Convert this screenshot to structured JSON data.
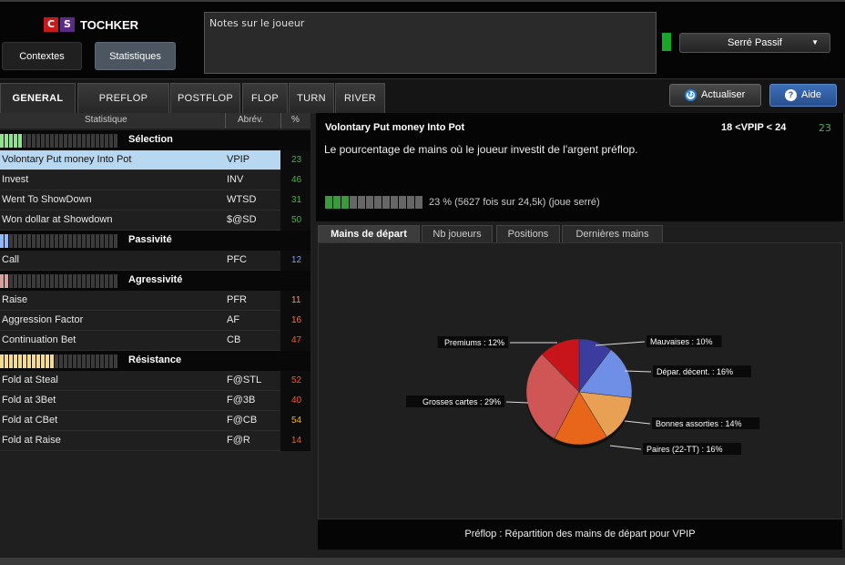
{
  "header": {
    "logo_c": "C",
    "logo_s": "S",
    "logo_name": "TOCHKER",
    "contextes_label": "Contextes",
    "statistiques_label": "Statistiques",
    "notes_placeholder": "Notes sur le joueur",
    "player_type": "Serré Passif"
  },
  "tabs": [
    "GENERAL",
    "PREFLOP",
    "POSTFLOP",
    "FLOP",
    "TURN",
    "RIVER"
  ],
  "actions": {
    "actualiser": "Actualiser",
    "aide": "Aide"
  },
  "table": {
    "col_stat": "Statistique",
    "col_abbr": "Abrév.",
    "col_pct": "%",
    "sections": [
      {
        "title": "Sélection",
        "meter_color": "#8fe38f",
        "meter_lit": 5,
        "rows": [
          {
            "label": "Volontary Put money Into Pot",
            "abbr": "VPIP",
            "value": "23",
            "color": "#4caf50",
            "selected": true
          },
          {
            "label": "Invest",
            "abbr": "INV",
            "value": "46",
            "color": "#4caf50"
          },
          {
            "label": "Went To ShowDown",
            "abbr": "WTSD",
            "value": "31",
            "color": "#4caf50"
          },
          {
            "label": "Won dollar at Showdown",
            "abbr": "$@SD",
            "value": "50",
            "color": "#4caf50"
          }
        ]
      },
      {
        "title": "Passivité",
        "meter_color": "#8fb8ff",
        "meter_lit": 2,
        "rows": [
          {
            "label": "Call",
            "abbr": "PFC",
            "value": "12",
            "color": "#6fa0ff"
          }
        ]
      },
      {
        "title": "Agressivité",
        "meter_color": "#d9a0a0",
        "meter_lit": 2,
        "rows": [
          {
            "label": "Raise",
            "abbr": "PFR",
            "value": "11",
            "color": "#ff8a65"
          },
          {
            "label": "Aggression Factor",
            "abbr": "AF",
            "value": "16",
            "color": "#ff7043"
          },
          {
            "label": "Continuation Bet",
            "abbr": "CB",
            "value": "47",
            "color": "#ff5722"
          }
        ]
      },
      {
        "title": "Résistance",
        "meter_color": "#f5dc8c",
        "meter_lit": 12,
        "rows": [
          {
            "label": "Fold at Steal",
            "abbr": "F@STL",
            "value": "52",
            "color": "#ff5722"
          },
          {
            "label": "Fold at 3Bet",
            "abbr": "F@3B",
            "value": "40",
            "color": "#ff5722"
          },
          {
            "label": "Fold at CBet",
            "abbr": "F@CB",
            "value": "54",
            "color": "#ffb300"
          },
          {
            "label": "Fold at Raise",
            "abbr": "F@R",
            "value": "14",
            "color": "#ff5722"
          }
        ]
      }
    ]
  },
  "detail": {
    "title": "Volontary Put money Into Pot",
    "range": "18 <VPIP < 24",
    "value": "23",
    "description": "Le pourcentage de mains où le joueur investit de l'argent préflop.",
    "meter_lit": 3,
    "meter_total": 12,
    "stat_line": "23 % (5627 fois sur 24,5k) (joue serré)"
  },
  "subtabs": [
    "Mains de départ",
    "Nb joueurs",
    "Positions",
    "Dernières mains"
  ],
  "chart_data": {
    "type": "pie",
    "title": "",
    "slices": [
      {
        "label": "Mauvaises : 10%",
        "value": 10,
        "color": "#3c3ca0"
      },
      {
        "label": "Dépar. décent. : 16%",
        "value": 16,
        "color": "#6f8fe6"
      },
      {
        "label": "Bonnes assorties : 14%",
        "value": 14,
        "color": "#e8a055"
      },
      {
        "label": "Paires (22-TT) : 16%",
        "value": 16,
        "color": "#e8661a"
      },
      {
        "label": "Grosses cartes : 29%",
        "value": 29,
        "color": "#d05656"
      },
      {
        "label": "Premiums : 12%",
        "value": 12,
        "color": "#c8151b"
      }
    ]
  },
  "caption": "Préflop : Répartition des mains de départ pour VPIP"
}
